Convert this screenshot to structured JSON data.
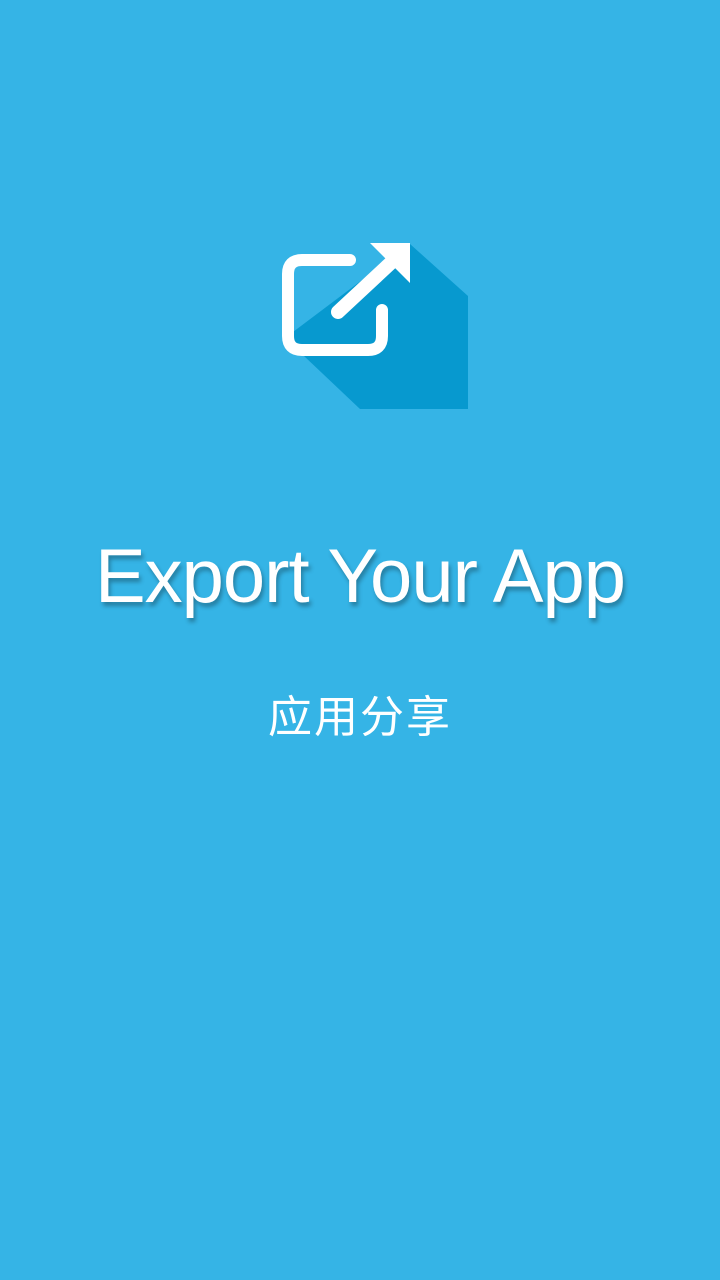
{
  "splash": {
    "title": "Export Your App",
    "subtitle": "应用分享",
    "logo_icon": "export-share-icon"
  },
  "colors": {
    "background": "#35b4e6",
    "icon_shadow": "#0799cf",
    "text": "#ffffff"
  }
}
